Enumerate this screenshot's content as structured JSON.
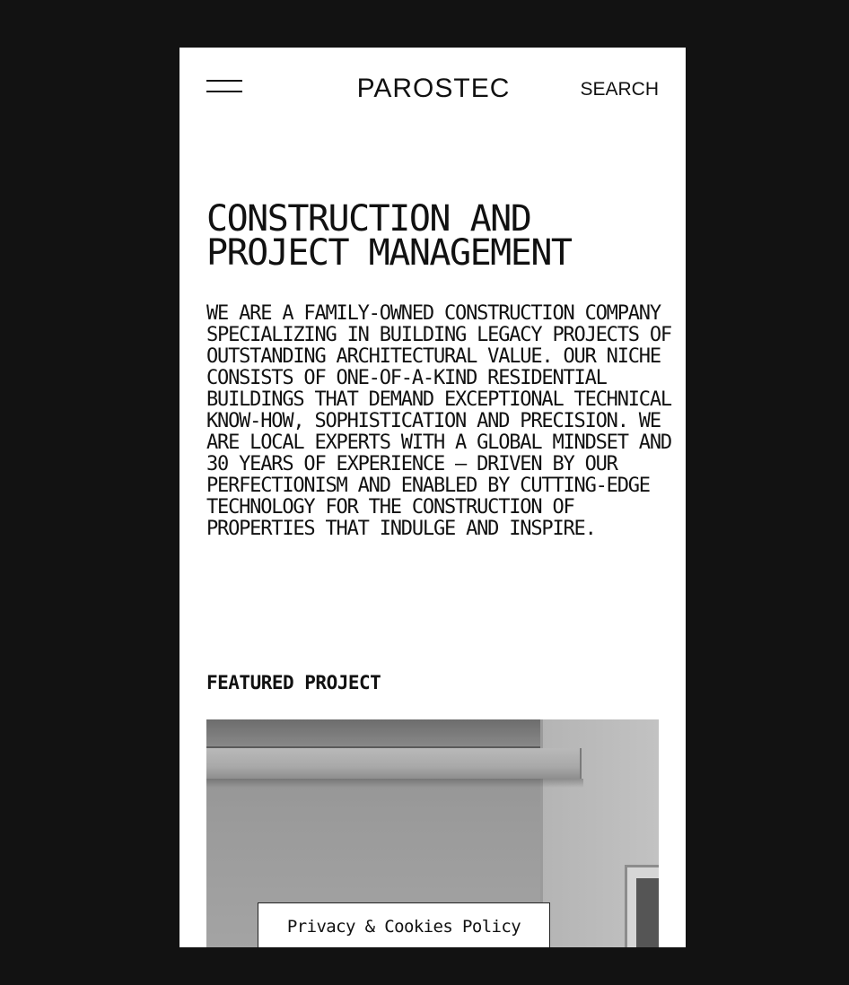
{
  "header": {
    "logo": "PAROSTEC",
    "search_label": "SEARCH",
    "menu_icon": "hamburger-menu-icon"
  },
  "hero": {
    "title": "CONSTRUCTION AND PROJECT MANAGEMENT",
    "intro": "WE ARE A FAMILY-OWNED CONSTRUCTION COMPANY SPECIALIZING IN BUILDING LEGACY PROJECTS OF OUTSTANDING ARCHITECTURAL VALUE. OUR NICHE CONSISTS OF ONE-OF-A-KIND RESIDENTIAL BUILDINGS THAT DEMAND EXCEPTIONAL TECHNICAL KNOW-HOW, SOPHISTICATION AND PRECISION. WE ARE LOCAL EXPERTS WITH A GLOBAL MINDSET AND 30 YEARS OF EXPERIENCE – DRIVEN BY OUR PERFECTIONISM AND ENABLED BY CUTTING-EDGE TECHNOLOGY FOR THE CONSTRUCTION OF PROPERTIES THAT INDULGE AND INSPIRE."
  },
  "featured": {
    "heading": "FEATURED PROJECT"
  },
  "cookie_banner": {
    "label": "Privacy & Cookies Policy"
  },
  "colors": {
    "page_background": "#121212",
    "screen_background": "#ffffff",
    "text": "#111111"
  }
}
